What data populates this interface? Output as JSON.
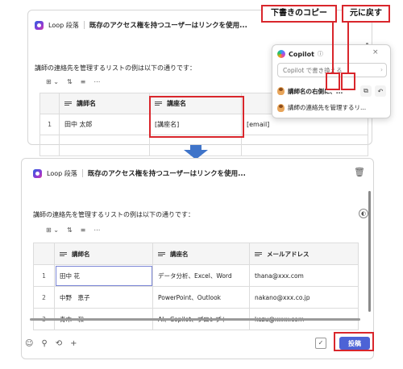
{
  "top": {
    "breadcrumb_app": "Loop 段落",
    "doc_title": "既存のアクセス権を持つユーザーはリンクを使用...",
    "intro_text": "講師の連絡先を管理するリストの例は以下の通りです：",
    "table": {
      "headers": [
        "講師名",
        "講座名"
      ],
      "rows": [
        {
          "num": "1",
          "cells": [
            "田中 太郎",
            "[講座名]",
            "[email]"
          ]
        }
      ]
    },
    "copilot": {
      "title": "Copilot",
      "info": "ⓘ",
      "input_placeholder": "Copilot で書き換える",
      "items": [
        "講師名の右側に、...",
        "講師の連絡先を管理するリ..."
      ]
    },
    "callouts": {
      "copy_draft": "下書きのコピー",
      "undo": "元に戻す"
    }
  },
  "bottom": {
    "breadcrumb_app": "Loop 段落",
    "doc_title": "既存のアクセス権を持つユーザーはリンクを使用...",
    "intro_text": "講師の連絡先を管理するリストの例は以下の通りです：",
    "table": {
      "headers": [
        "講師名",
        "講座名",
        "メールアドレス"
      ],
      "rows": [
        {
          "num": "1",
          "cells": [
            "田中 花",
            "データ分析、Excel、Word",
            "thana@xxx.com"
          ]
        },
        {
          "num": "2",
          "cells": [
            "中野　恵子",
            "PowerPoint、Outlook",
            "nakano@xxx.co.jp"
          ]
        },
        {
          "num": "3",
          "cells": [
            "青木　和",
            "AI、Copilot、プロンプト",
            "kazu@xxxx.com"
          ]
        }
      ]
    },
    "post_label": "投稿"
  },
  "colors": {
    "highlight_red": "#d9262c",
    "post_blue": "#4d63d6",
    "arrow_blue": "#3f74c9"
  }
}
